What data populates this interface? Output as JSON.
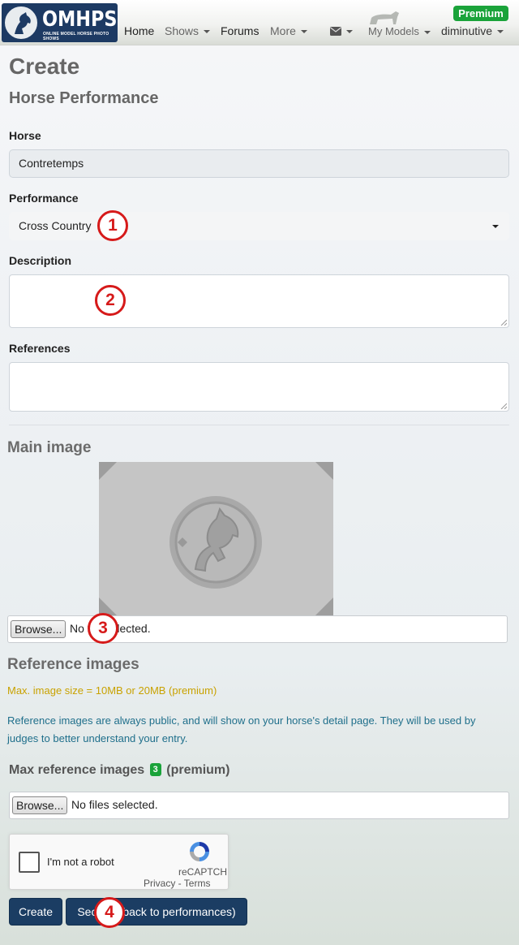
{
  "nav": {
    "logo_text": "OMHPS",
    "logo_sub": "ONLINE MODEL HORSE PHOTO SHOWS",
    "home": "Home",
    "shows": "Shows",
    "forums": "Forums",
    "more": "More",
    "my_models": "My Models",
    "username": "diminutive",
    "premium": "Premium"
  },
  "page": {
    "title": "Create",
    "subtitle": "Horse Performance"
  },
  "form": {
    "horse_label": "Horse",
    "horse_value": "Contretemps",
    "performance_label": "Performance",
    "performance_value": "Cross Country",
    "description_label": "Description",
    "description_value": "",
    "references_label": "References",
    "references_value": ""
  },
  "main_image": {
    "heading": "Main image",
    "browse_label": "Browse...",
    "file_status": "No file selected."
  },
  "reference_images": {
    "heading": "Reference images",
    "size_note": "Max. image size = 10MB or 20MB (premium)",
    "info_note": "Reference images are always public, and will show on your horse's detail page. They will be used by judges to better understand your entry.",
    "max_label": "Max reference images",
    "max_count": "3",
    "premium_suffix": "(premium)",
    "browse_label": "Browse...",
    "file_status": "No files selected."
  },
  "captcha": {
    "label": "I'm not a robot",
    "brand": "reCAPTCH",
    "links": "Privacy - Terms"
  },
  "actions": {
    "create": "Create",
    "second": "Second (back to performances)"
  },
  "markers": [
    "1",
    "2",
    "3",
    "4"
  ],
  "colors": {
    "brand_navy": "#1b3d63",
    "premium_green": "#1aa33a",
    "warning_yellow": "#c9a200",
    "info_teal": "#1f6f8b",
    "marker_red": "#d61a1a"
  }
}
